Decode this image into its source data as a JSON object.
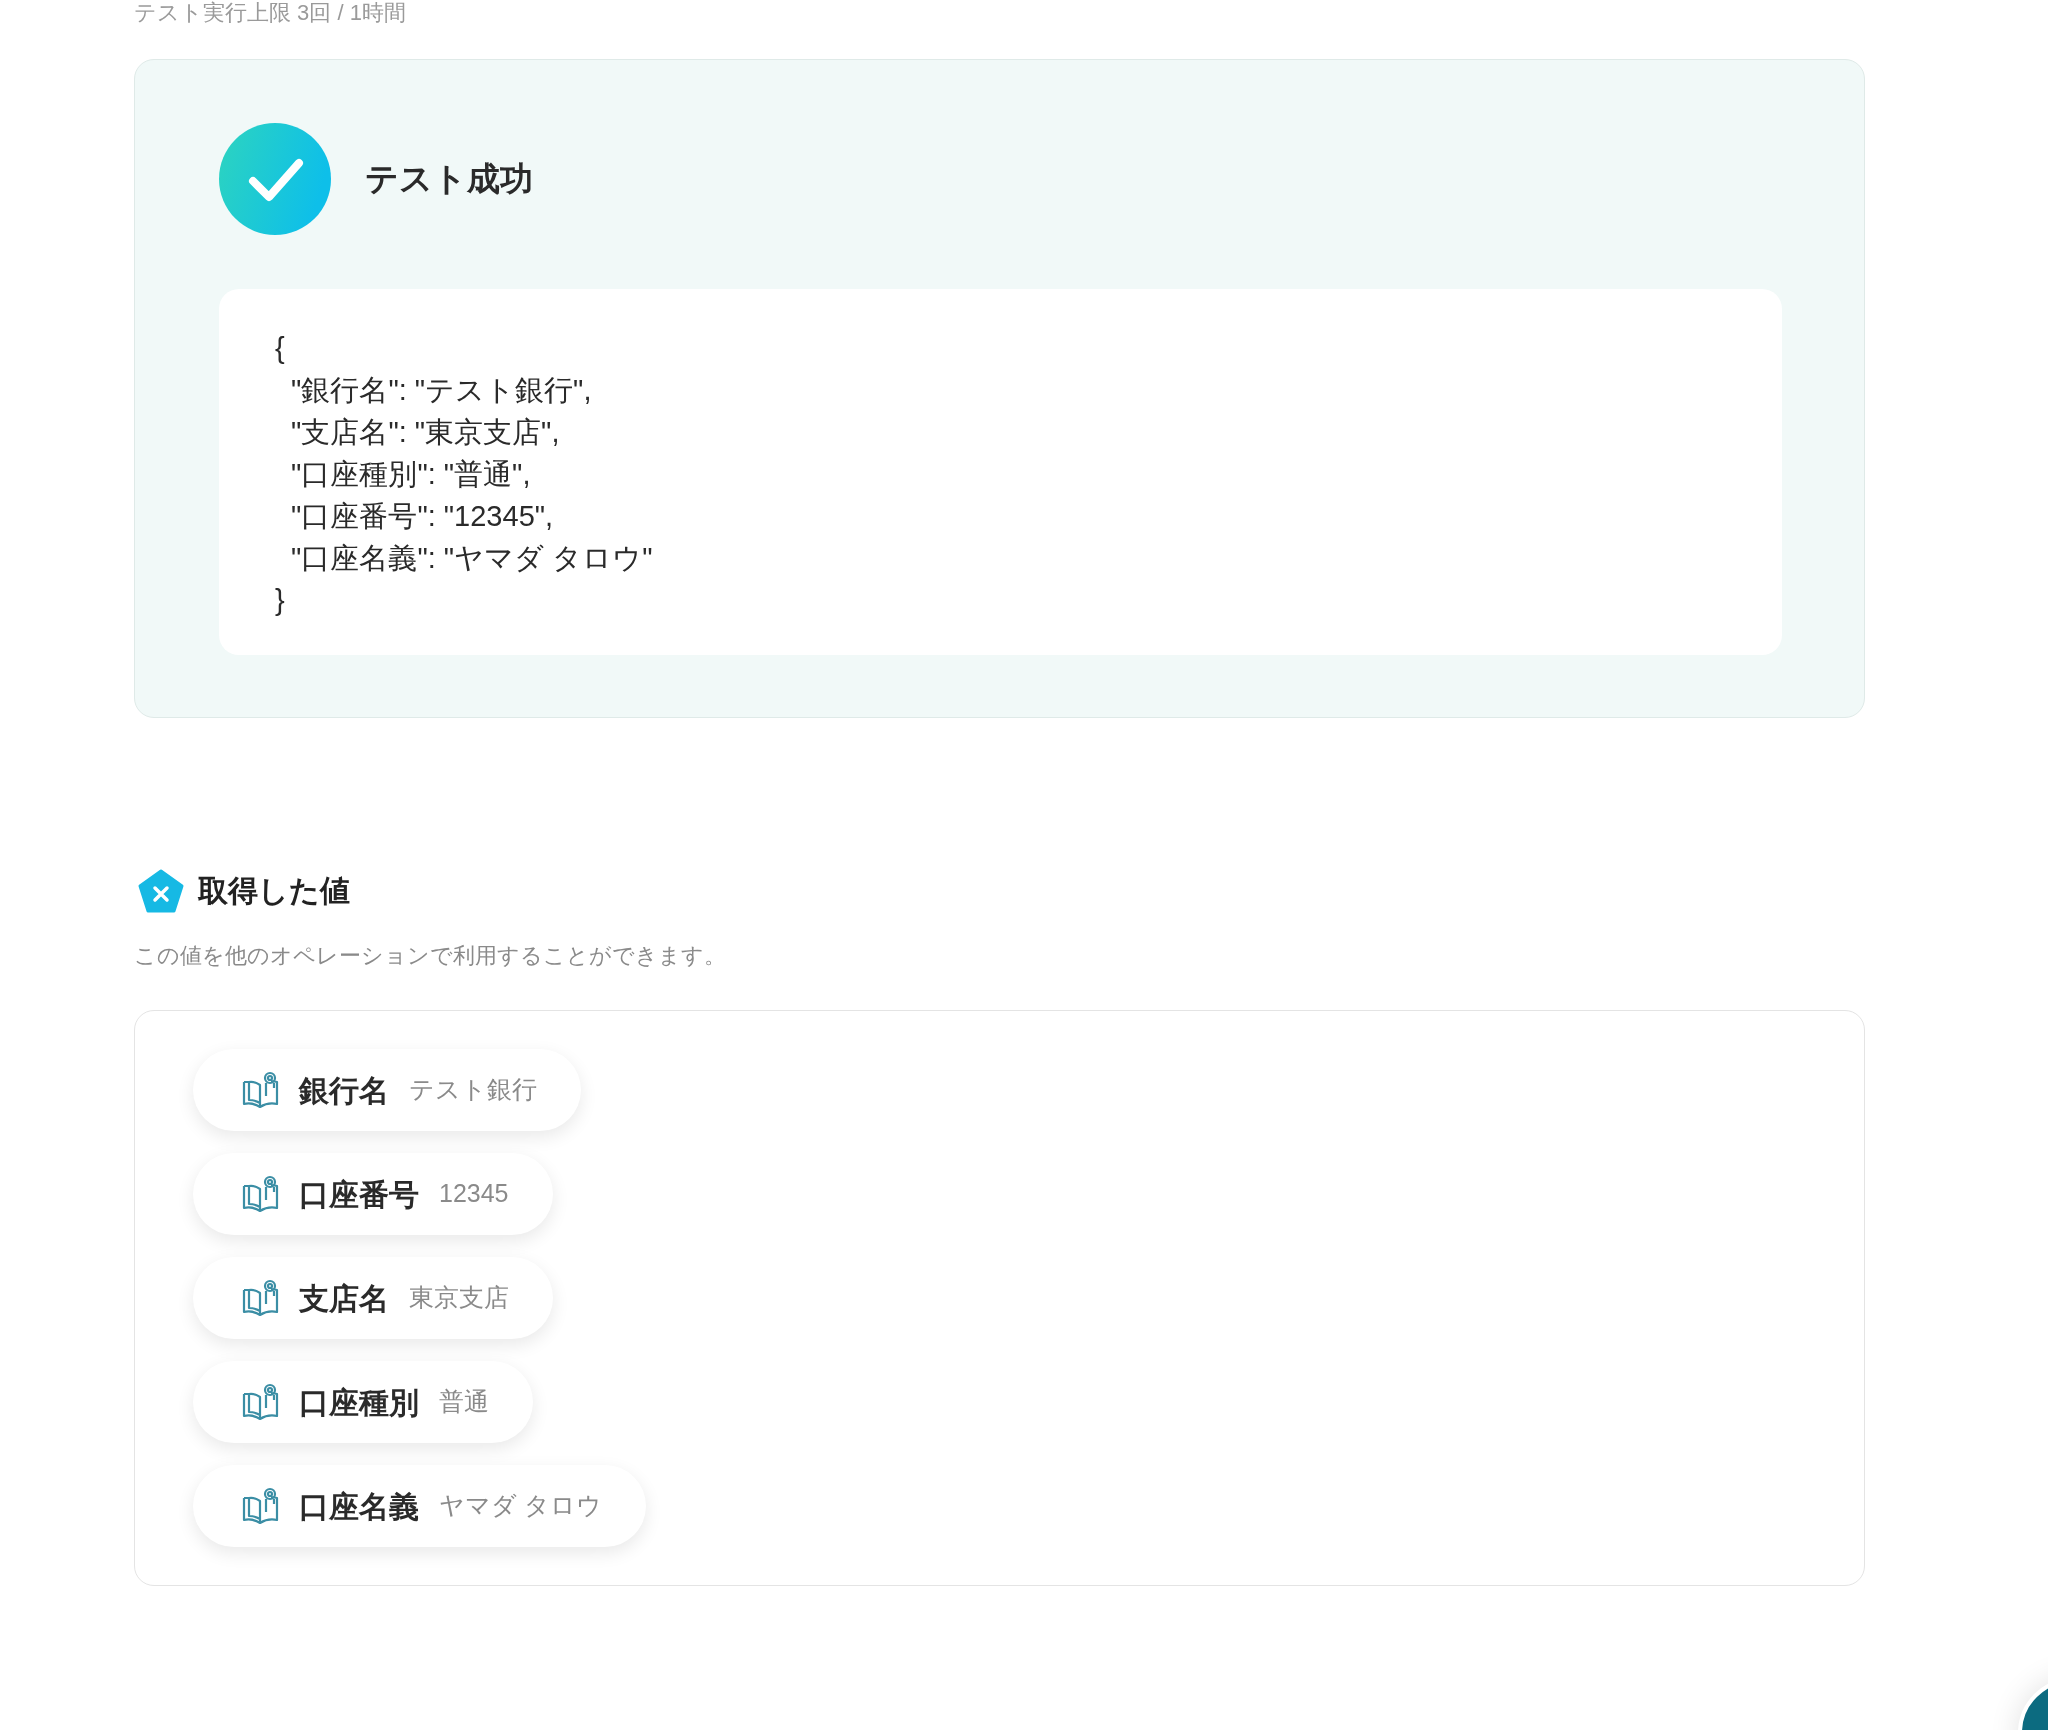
{
  "test_limit": "テスト実行上限 3回 / 1時間",
  "result": {
    "success": true,
    "title": "テスト成功",
    "code_lines": [
      "{",
      "  \"銀行名\": \"テスト銀行\",",
      "  \"支店名\": \"東京支店\",",
      "  \"口座種別\": \"普通\",",
      "  \"口座番号\": \"12345\",",
      "  \"口座名義\": \"ヤマダ タロウ\"",
      "}"
    ]
  },
  "values_section": {
    "title": "取得した値",
    "description": "この値を他のオペレーションで利用することができます。",
    "items": [
      {
        "label": "銀行名",
        "value": "テスト銀行"
      },
      {
        "label": "口座番号",
        "value": "12345"
      },
      {
        "label": "支店名",
        "value": "東京支店"
      },
      {
        "label": "口座種別",
        "value": "普通"
      },
      {
        "label": "口座名義",
        "value": "ヤマダ タロウ"
      }
    ]
  }
}
